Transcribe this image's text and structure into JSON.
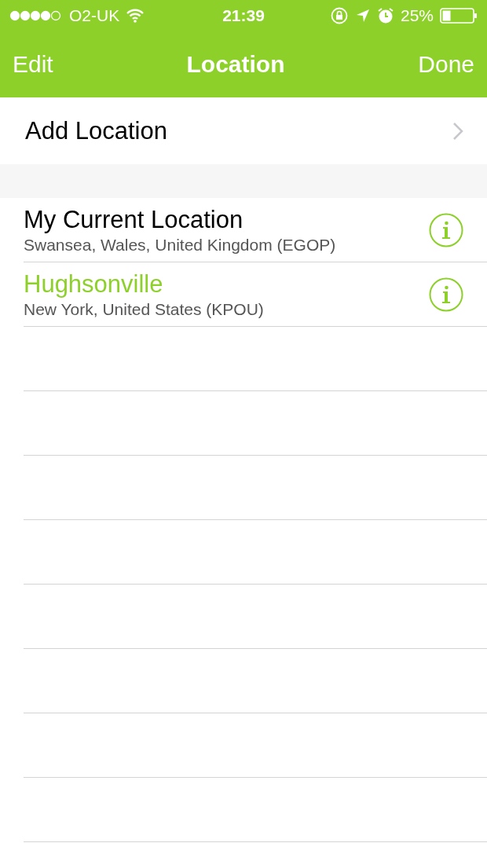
{
  "status_bar": {
    "carrier": "O2-UK",
    "time": "21:39",
    "battery": "25%"
  },
  "nav_bar": {
    "left": "Edit",
    "title": "Location",
    "right": "Done"
  },
  "add_row": {
    "label": "Add Location"
  },
  "locations": [
    {
      "name": "My Current Location",
      "detail": "Swansea, Wales, United Kingdom (EGOP)",
      "selected": false
    },
    {
      "name": "Hughsonville",
      "detail": "New York, United States (KPOU)",
      "selected": true
    }
  ]
}
